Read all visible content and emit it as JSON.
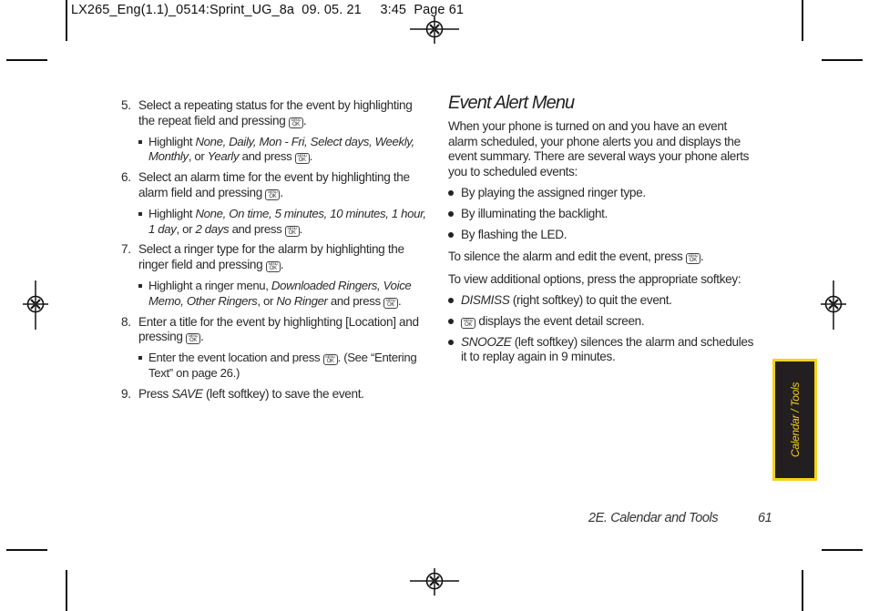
{
  "slug": "LX265_Eng(1.1)_0514:Sprint_UG_8a  09. 05. 21     3:45  Page 61",
  "key_icon": {
    "name": "menu-ok-key",
    "top": "MENU",
    "bottom": "OK"
  },
  "left_column": {
    "steps": [
      {
        "num": "5.",
        "text_before": "Select a repeating status for the event by highlighting the repeat field and pressing ",
        "text_after": ".",
        "sub": {
          "prefix": "Highlight ",
          "options": "None, Daily, Mon - Fri, Select days, Weekly, Monthly",
          "joiner": ", or ",
          "last_option": "Yearly",
          "suffix": " and press ",
          "end": "."
        }
      },
      {
        "num": "6.",
        "text_before": "Select an alarm time for the event by highlighting the alarm field and pressing ",
        "text_after": ".",
        "sub": {
          "prefix": "Highlight ",
          "options": "None, On time, 5 minutes, 10 minutes, 1 hour, 1 day",
          "joiner": ", or ",
          "last_option": "2 days",
          "suffix": " and press ",
          "end": "."
        }
      },
      {
        "num": "7.",
        "text_before": "Select a ringer type for the alarm by highlighting the ringer field and pressing ",
        "text_after": ".",
        "sub": {
          "prefix": "Highlight a ringer menu, ",
          "options": "Downloaded Ringers, Voice Memo, Other Ringers",
          "joiner": ", or ",
          "last_option": "No Ringer",
          "suffix": " and press ",
          "end": "."
        }
      },
      {
        "num": "8.",
        "text_before": "Enter a title for the event by highlighting [Location] and pressing ",
        "text_after": ".",
        "sub": {
          "prefix": "Enter the event location and press ",
          "suffix": ". (See “Entering Text” on page 26.)"
        }
      },
      {
        "num": "9.",
        "prefix": "Press ",
        "softkey": "SAVE",
        "suffix": " (left softkey) to save the event."
      }
    ]
  },
  "right_column": {
    "heading": "Event Alert Menu",
    "intro": "When your phone is turned on and you have an event alarm scheduled, your phone alerts you and displays the event summary. There are several ways your phone alerts you to scheduled events:",
    "alert_bullets": [
      "By playing the assigned ringer type.",
      "By illuminating the backlight.",
      "By flashing the LED."
    ],
    "silence_text": "To silence the alarm and edit the event, press ",
    "silence_end": ".",
    "options_text": "To view additional options, press the appropriate softkey:",
    "option_bullets": {
      "dismiss": {
        "softkey": "DISMISS",
        "text": " (right softkey) to quit the event."
      },
      "ok": {
        "text": " displays the event detail screen."
      },
      "snooze": {
        "softkey": "SNOOZE",
        "text": " (left softkey) silences the alarm and schedules it to replay again in 9 minutes."
      }
    }
  },
  "side_tab": {
    "label": "Calendar / Tools",
    "background": "#231f20",
    "accent": "#f4d11a"
  },
  "footer": {
    "section": "2E. Calendar and Tools",
    "page_number": "61"
  }
}
